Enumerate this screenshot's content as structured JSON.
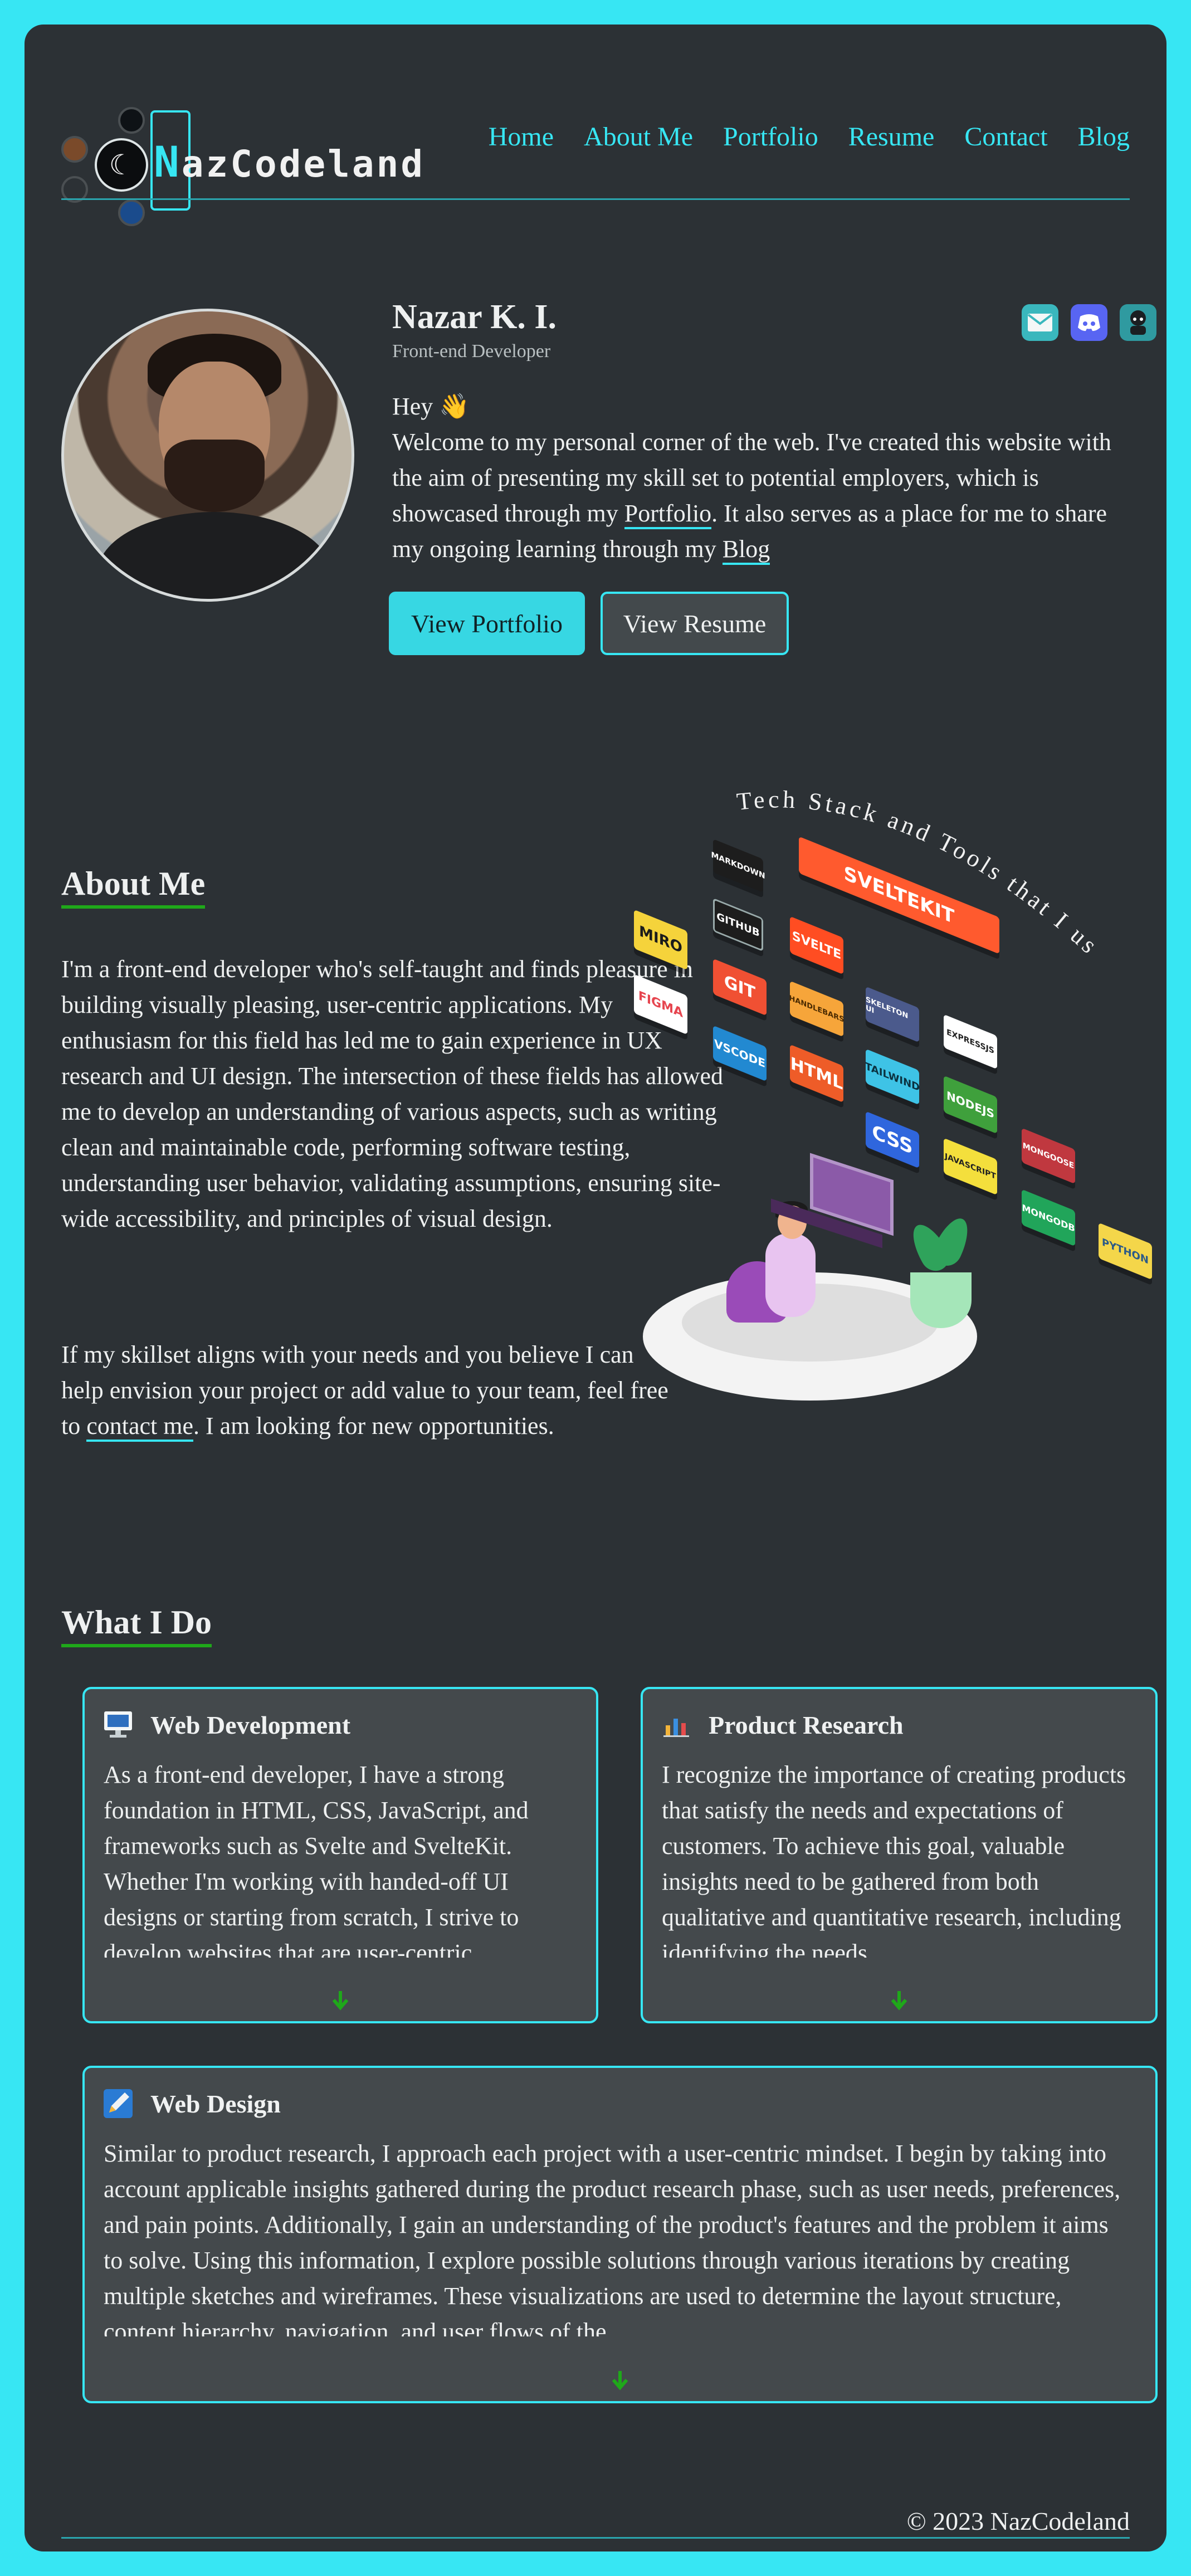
{
  "brand": {
    "name_first": "N",
    "name_rest": "azCodeland"
  },
  "nav": [
    {
      "label": "Home"
    },
    {
      "label": "About Me"
    },
    {
      "label": "Portfolio"
    },
    {
      "label": "Resume"
    },
    {
      "label": "Contact"
    },
    {
      "label": "Blog"
    }
  ],
  "hero": {
    "name": "Nazar K. I.",
    "role": "Front-end Developer",
    "greeting": "Hey 👋",
    "intro_1": "Welcome to my personal corner of the web. I've created this website with the aim of presenting my skill set to potential employers, which is showcased through my ",
    "portfolio_link": "Portfolio",
    "intro_2": ". It also serves as a place for me to share my ongoing learning through my ",
    "blog_link": "Blog",
    "primary_button": "View Portfolio",
    "secondary_button": "View Resume"
  },
  "socials": [
    {
      "icon": "email-icon"
    },
    {
      "icon": "discord-icon"
    },
    {
      "icon": "github-icon"
    }
  ],
  "about": {
    "title": "About Me",
    "p1": "I'm a front-end developer who's self-taught and finds pleasure in building visually pleasing, user-centric applications. My enthusiasm for this field has led me to gain experience in UX research and UI design. The intersection of these fields has allowed me to develop an understanding of various aspects, such as writing clean and maintainable code, performing software testing, understanding user behavior, validating assumptions, ensuring site-wide accessibility, and principles of visual design.",
    "p2_before": "If my skillset aligns with your needs and you believe I can help envision your project or add value to your team, feel free to ",
    "contact_link": "contact me",
    "p2_after": ". I am looking for new opportunities."
  },
  "tech": {
    "caption": "Tech Stack and Tools that I use",
    "tools": [
      "MARKDOWN",
      "GITHUB",
      "MIRO",
      "FIGMA",
      "GIT",
      "VSCODE",
      "SVELTE",
      "HANDLEBARS",
      "HTML",
      "SKELETON UI",
      "TAILWIND",
      "CSS",
      "SVELTEKIT",
      "EXPRESSJS",
      "NODEJS",
      "JAVASCRIPT",
      "MONGOOSE",
      "MONGODB",
      "PYTHON"
    ]
  },
  "what_i_do": {
    "title": "What I Do",
    "cards": [
      {
        "title": "Web Development",
        "icon": "monitor-icon",
        "body": "As a front-end developer, I have a strong foundation in HTML, CSS, JavaScript, and frameworks such as Svelte and SvelteKit. Whether I'm working with handed-off UI designs or starting from scratch, I strive to develop websites that are user-centric,"
      },
      {
        "title": "Product Research",
        "icon": "chart-icon",
        "body": "I recognize the importance of creating products that satisfy the needs and expectations of customers. To achieve this goal, valuable insights need to be gathered from both qualitative and quantitative research, including identifying the needs,"
      },
      {
        "title": "Web Design",
        "icon": "pen-icon",
        "body": "Similar to product research, I approach each project with a user-centric mindset. I begin by taking into account applicable insights gathered during the product research phase, such as user needs, preferences, and pain points. Additionally, I gain an understanding of the product's features and the problem it aims to solve. Using this information, I explore possible solutions through various iterations by creating multiple sketches and wireframes. These visualizations are used to determine the layout structure, content hierarchy, navigation, and user flows of the"
      }
    ]
  },
  "footer": {
    "copyright": "© 2023 NazCodeland"
  },
  "colors": {
    "accent": "#37e6f3",
    "background": "#2c3135",
    "card": "#44494c",
    "underline": "#1fa81a"
  }
}
